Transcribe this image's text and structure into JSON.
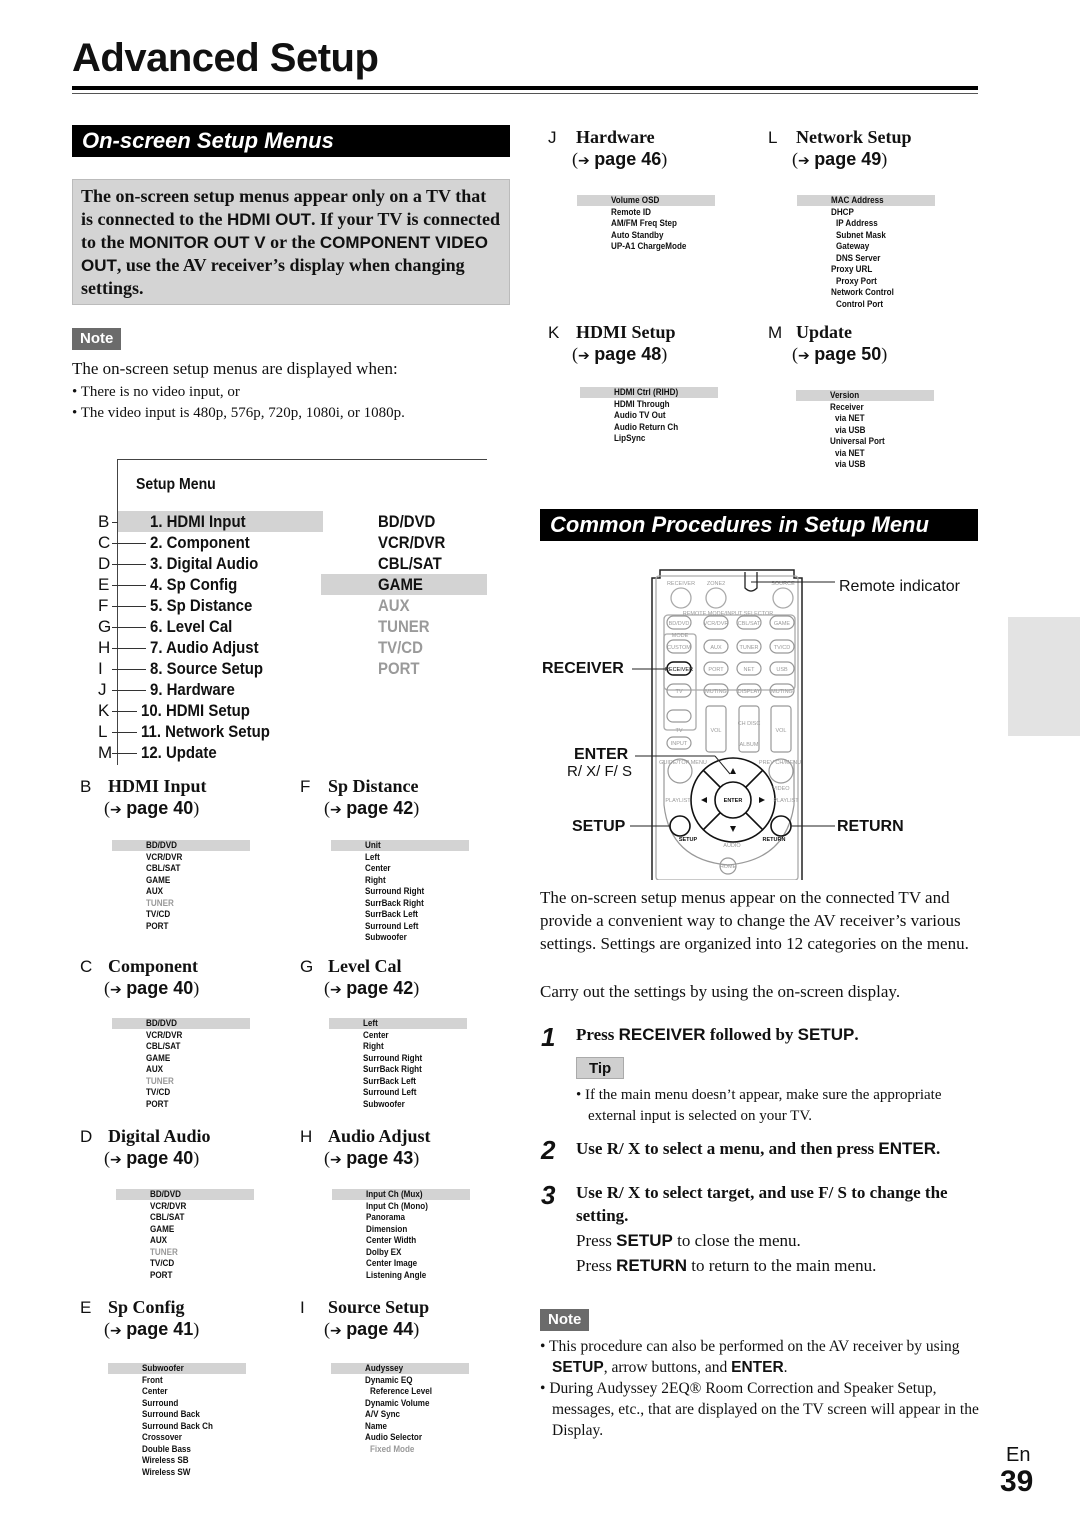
{
  "page": {
    "title": "Advanced Setup",
    "language": "En",
    "number": "39"
  },
  "onscreen_section": {
    "heading": "On-screen Setup Menus",
    "intro": [
      {
        "t": "The on-screen setup menus appear only on a TV that is connected to the ",
        "s": false
      },
      {
        "t": "HDMI OUT",
        "s": true
      },
      {
        "t": ". If your TV is connected to the ",
        "s": false
      },
      {
        "t": "MONITOR OUT V",
        "s": true
      },
      {
        "t": " or the ",
        "s": false
      },
      {
        "t": "COMPONENT VIDEO OUT",
        "s": true
      },
      {
        "t": ", use the AV receiver’s display when changing settings.",
        "s": false
      }
    ],
    "note_label": "Note",
    "note_text": "The on-screen setup menus are displayed when:",
    "note_bullets": [
      "There is no video input, or",
      "The video input is 480p, 576p, 720p, 1080i, or 1080p."
    ]
  },
  "setup_menu": {
    "title": "Setup Menu",
    "items": [
      {
        "letter": "B",
        "label": "1. HDMI Input",
        "highlighted": true
      },
      {
        "letter": "C",
        "label": "2. Component",
        "highlighted": false
      },
      {
        "letter": "D",
        "label": "3. Digital Audio",
        "highlighted": false
      },
      {
        "letter": "E",
        "label": "4. Sp Config",
        "highlighted": false
      },
      {
        "letter": "F",
        "label": "5. Sp Distance",
        "highlighted": false
      },
      {
        "letter": "G",
        "label": "6. Level Cal",
        "highlighted": false
      },
      {
        "letter": "H",
        "label": "7. Audio Adjust",
        "highlighted": false
      },
      {
        "letter": "I",
        "label": "8. Source Setup",
        "highlighted": false
      },
      {
        "letter": "J",
        "label": "9. Hardware",
        "highlighted": false
      },
      {
        "letter": "K",
        "label": "10. HDMI Setup",
        "highlighted": false
      },
      {
        "letter": "L",
        "label": "11. Network Setup",
        "highlighted": false
      },
      {
        "letter": "M",
        "label": "12. Update",
        "highlighted": false
      }
    ],
    "inputs": [
      {
        "label": "BD/DVD",
        "highlighted": false,
        "greyed": false
      },
      {
        "label": "VCR/DVR",
        "highlighted": false,
        "greyed": false
      },
      {
        "label": "CBL/SAT",
        "highlighted": false,
        "greyed": false
      },
      {
        "label": "GAME",
        "highlighted": true,
        "greyed": false
      },
      {
        "label": "AUX",
        "highlighted": false,
        "greyed": true
      },
      {
        "label": "TUNER",
        "highlighted": false,
        "greyed": true
      },
      {
        "label": "TV/CD",
        "highlighted": false,
        "greyed": true
      },
      {
        "label": "PORT",
        "highlighted": false,
        "greyed": true
      }
    ]
  },
  "submenus": [
    {
      "letter": "B",
      "title": "HDMI Input",
      "page": "page 40",
      "items": [
        {
          "t": "BD/DVD"
        },
        {
          "t": "VCR/DVR"
        },
        {
          "t": "CBL/SAT"
        },
        {
          "t": "GAME"
        },
        {
          "t": "AUX"
        },
        {
          "t": "TUNER",
          "g": true
        },
        {
          "t": "TV/CD"
        },
        {
          "t": "PORT"
        }
      ]
    },
    {
      "letter": "C",
      "title": "Component",
      "page": "page 40",
      "items": [
        {
          "t": "BD/DVD"
        },
        {
          "t": "VCR/DVR"
        },
        {
          "t": "CBL/SAT"
        },
        {
          "t": "GAME"
        },
        {
          "t": "AUX"
        },
        {
          "t": "TUNER",
          "g": true
        },
        {
          "t": "TV/CD"
        },
        {
          "t": "PORT"
        }
      ]
    },
    {
      "letter": "D",
      "title": "Digital Audio",
      "page": "page 40",
      "items": [
        {
          "t": "BD/DVD"
        },
        {
          "t": "VCR/DVR"
        },
        {
          "t": "CBL/SAT"
        },
        {
          "t": "GAME"
        },
        {
          "t": "AUX"
        },
        {
          "t": "TUNER",
          "g": true
        },
        {
          "t": "TV/CD"
        },
        {
          "t": "PORT"
        }
      ]
    },
    {
      "letter": "E",
      "title": "Sp Config",
      "page": "page 41",
      "items": [
        {
          "t": "Subwoofer"
        },
        {
          "t": "Front"
        },
        {
          "t": "Center"
        },
        {
          "t": "Surround"
        },
        {
          "t": "Surround Back"
        },
        {
          "t": "Surround Back Ch"
        },
        {
          "t": "Crossover"
        },
        {
          "t": "Double Bass"
        },
        {
          "t": "Wireless SB"
        },
        {
          "t": "Wireless SW"
        }
      ]
    },
    {
      "letter": "F",
      "title": "Sp Distance",
      "page": "page 42",
      "items": [
        {
          "t": "Unit"
        },
        {
          "t": "Left"
        },
        {
          "t": "Center"
        },
        {
          "t": "Right"
        },
        {
          "t": "Surround Right"
        },
        {
          "t": "SurrBack Right"
        },
        {
          "t": "SurrBack Left"
        },
        {
          "t": "Surround Left"
        },
        {
          "t": "Subwoofer"
        }
      ]
    },
    {
      "letter": "G",
      "title": "Level Cal",
      "page": "page 42",
      "items": [
        {
          "t": "Left"
        },
        {
          "t": "Center"
        },
        {
          "t": "Right"
        },
        {
          "t": "Surround Right"
        },
        {
          "t": "SurrBack Right"
        },
        {
          "t": "SurrBack Left"
        },
        {
          "t": "Surround Left"
        },
        {
          "t": "Subwoofer"
        }
      ]
    },
    {
      "letter": "H",
      "title": "Audio Adjust",
      "page": "page 43",
      "items": [
        {
          "t": "Input Ch (Mux)"
        },
        {
          "t": "Input Ch (Mono)"
        },
        {
          "t": "Panorama"
        },
        {
          "t": "Dimension"
        },
        {
          "t": "Center Width"
        },
        {
          "t": "Dolby EX"
        },
        {
          "t": "Center Image"
        },
        {
          "t": "Listening Angle"
        }
      ]
    },
    {
      "letter": "I",
      "title": "Source Setup",
      "page": "page 44",
      "items": [
        {
          "t": "Audyssey"
        },
        {
          "t": "Dynamic EQ"
        },
        {
          "t": "Reference Level",
          "i": true
        },
        {
          "t": "Dynamic Volume"
        },
        {
          "t": "A/V Sync"
        },
        {
          "t": "Name"
        },
        {
          "t": "Audio Selector"
        },
        {
          "t": "Fixed Mode",
          "i": true,
          "g": true
        }
      ]
    },
    {
      "letter": "J",
      "title": "Hardware",
      "page": "page 46",
      "items": [
        {
          "t": "Volume OSD"
        },
        {
          "t": "Remote ID"
        },
        {
          "t": "AM/FM Freq Step"
        },
        {
          "t": "Auto Standby"
        },
        {
          "t": "UP-A1 ChargeMode"
        }
      ]
    },
    {
      "letter": "K",
      "title": "HDMI Setup",
      "page": "page 48",
      "items": [
        {
          "t": "HDMI Ctrl (RIHD)"
        },
        {
          "t": "HDMI Through"
        },
        {
          "t": "Audio TV Out"
        },
        {
          "t": "Audio Return Ch"
        },
        {
          "t": "LipSync"
        }
      ]
    },
    {
      "letter": "L",
      "title": "Network Setup",
      "page": "page 49",
      "items": [
        {
          "t": "MAC Address"
        },
        {
          "t": "DHCP"
        },
        {
          "t": "IP Address",
          "i": true
        },
        {
          "t": "Subnet Mask",
          "i": true
        },
        {
          "t": "Gateway",
          "i": true
        },
        {
          "t": "DNS Server",
          "i": true
        },
        {
          "t": "Proxy URL"
        },
        {
          "t": "Proxy Port",
          "i": true
        },
        {
          "t": "Network Control"
        },
        {
          "t": "Control Port",
          "i": true
        }
      ]
    },
    {
      "letter": "M",
      "title": "Update",
      "page": "page 50",
      "items": [
        {
          "t": "Version"
        },
        {
          "t": "Receiver"
        },
        {
          "t": "via NET",
          "i": true
        },
        {
          "t": "via USB",
          "i": true
        },
        {
          "t": "Universal Port"
        },
        {
          "t": "via NET",
          "i": true
        },
        {
          "t": "via USB",
          "i": true
        }
      ]
    }
  ],
  "common_section": {
    "heading": "Common Procedures in Setup Menu",
    "remote": {
      "callouts": {
        "remote_indicator": "Remote indicator",
        "receiver": "RECEIVER",
        "enter": "ENTER",
        "arrows": "R/ X/ F/ S",
        "setup": "SETUP",
        "return": "RETURN"
      },
      "labels": {
        "receiver_top": "RECEIVER",
        "zone2": "ZONE2",
        "source": "SOURCE",
        "selector": "REMOTE MODE/INPUT SELECTOR",
        "mode": "MODE",
        "row1": [
          "BD/DVD",
          "VCR/DVR",
          "CBL/SAT",
          "GAME"
        ],
        "row2": [
          "CUSTOM",
          "AUX",
          "TUNER",
          "TV/CD"
        ],
        "row3": [
          "RECEIVER",
          "PORT",
          "NET",
          "USB"
        ],
        "row4": [
          "TV",
          "MUTING",
          "DISPLAY",
          "MUTING"
        ],
        "tv": "TV",
        "input": "INPUT",
        "vol": "VOL",
        "ch_disc": "CH DISC",
        "album": "ALBUM",
        "guide": "GUIDE/TOP MENU",
        "prev": "PREV CH/MENU",
        "video": "VIDEO",
        "playlist": "PLAYLIST",
        "enter_btn": "ENTER",
        "setup_btn": "SETUP",
        "return_btn": "RETURN",
        "audio": "AUDIO",
        "home": "HOME"
      }
    },
    "description": [
      "The on-screen setup menus appear on the connected TV and provide a convenient way to change the AV receiver’s various settings. Settings are organized into 12 categories on the menu.",
      "Carry out the settings by using the on-screen display."
    ],
    "steps": [
      {
        "number": "1",
        "parts": [
          {
            "t": "Press ",
            "s": false
          },
          {
            "t": "RECEIVER",
            "s": true
          },
          {
            "t": " followed by ",
            "s": false
          },
          {
            "t": "SETUP",
            "s": true
          },
          {
            "t": ".",
            "s": false
          }
        ]
      },
      {
        "number": "2",
        "parts": [
          {
            "t": "Use  R/ X to select a menu, and then press ",
            "s": false
          },
          {
            "t": "ENTER",
            "s": true
          },
          {
            "t": ".",
            "s": false
          }
        ]
      },
      {
        "number": "3",
        "parts": [
          {
            "t": "Use  R/ X to select target, and use  F/ S to change the setting.",
            "s": false
          }
        ]
      }
    ],
    "tip_label": "Tip",
    "tip_text": "If the main menu doesn’t appear, make sure the appropriate external input is selected on your TV.",
    "step3_lines": [
      [
        {
          "t": "Press ",
          "s": false
        },
        {
          "t": "SETUP",
          "s": true
        },
        {
          "t": " to close the menu.",
          "s": false
        }
      ],
      [
        {
          "t": "Press ",
          "s": false
        },
        {
          "t": "RETURN",
          "s": true
        },
        {
          "t": " to return to the main menu.",
          "s": false
        }
      ]
    ],
    "note_label": "Note",
    "note_bullets": [
      [
        {
          "t": "This procedure can also be performed on the AV receiver by using ",
          "s": false
        },
        {
          "t": "SETUP",
          "s": true
        },
        {
          "t": ", arrow buttons, and ",
          "s": false
        },
        {
          "t": "ENTER",
          "s": true
        },
        {
          "t": ".",
          "s": false
        }
      ],
      [
        {
          "t": "During Audyssey 2EQ® Room Correction and Speaker Setup, messages, etc., that are displayed on the TV screen will appear in the Display.",
          "s": false
        }
      ]
    ]
  }
}
